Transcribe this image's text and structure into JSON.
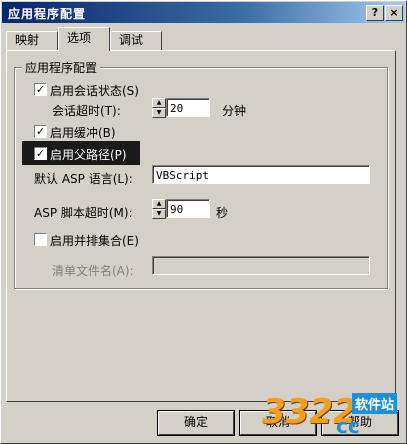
{
  "window": {
    "title": "应用程序配置",
    "help_glyph": "?",
    "close_glyph": "×"
  },
  "tabs": [
    {
      "label": "映射",
      "active": false
    },
    {
      "label": "选项",
      "active": true
    },
    {
      "label": "调试",
      "active": false
    }
  ],
  "group": {
    "label": "应用程序配置",
    "enable_session": {
      "label": "启用会话状态(S)",
      "checked": true
    },
    "session_timeout": {
      "label": "会话超时(T):",
      "value": "20",
      "unit": "分钟"
    },
    "enable_buffer": {
      "label": "启用缓冲(B)",
      "checked": true
    },
    "enable_parent_paths": {
      "label": "启用父路径(P)",
      "checked": true
    },
    "default_language": {
      "label": "默认 ASP 语言(L):",
      "value": "VBScript"
    },
    "script_timeout": {
      "label": "ASP 脚本超时(M):",
      "value": "90",
      "unit": "秒"
    },
    "enable_side_by_side": {
      "label": "启用并排集合(E)",
      "checked": false
    },
    "manifest_file": {
      "label": "清单文件名(A):",
      "value": ""
    }
  },
  "buttons": {
    "ok": "确定",
    "cancel": "取消",
    "help": "帮助"
  },
  "watermark": {
    "brand": "3322",
    "domain": "cc",
    "site_label": "软件站"
  }
}
